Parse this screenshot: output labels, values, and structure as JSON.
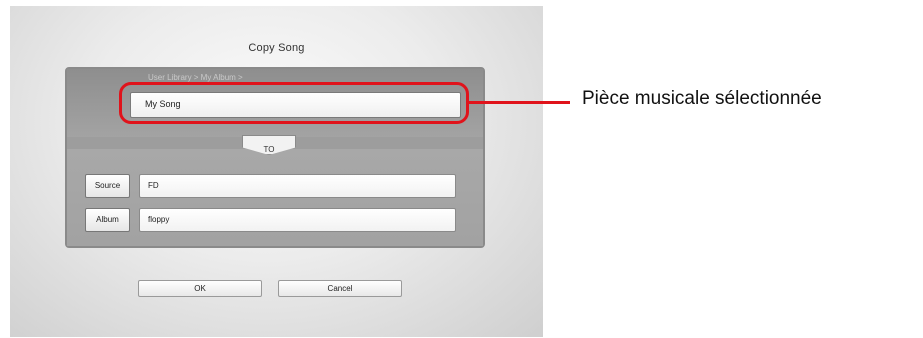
{
  "dialog": {
    "title": "Copy Song",
    "breadcrumb": "User Library > My Album >",
    "selected_song": "My Song",
    "to_label": "TO",
    "source_button": "Source",
    "source_value": "FD",
    "album_button": "Album",
    "album_value": "floppy",
    "ok_button": "OK",
    "cancel_button": "Cancel"
  },
  "annotation": {
    "label": "Pièce musicale sélectionnée",
    "color": "#e0131b"
  }
}
